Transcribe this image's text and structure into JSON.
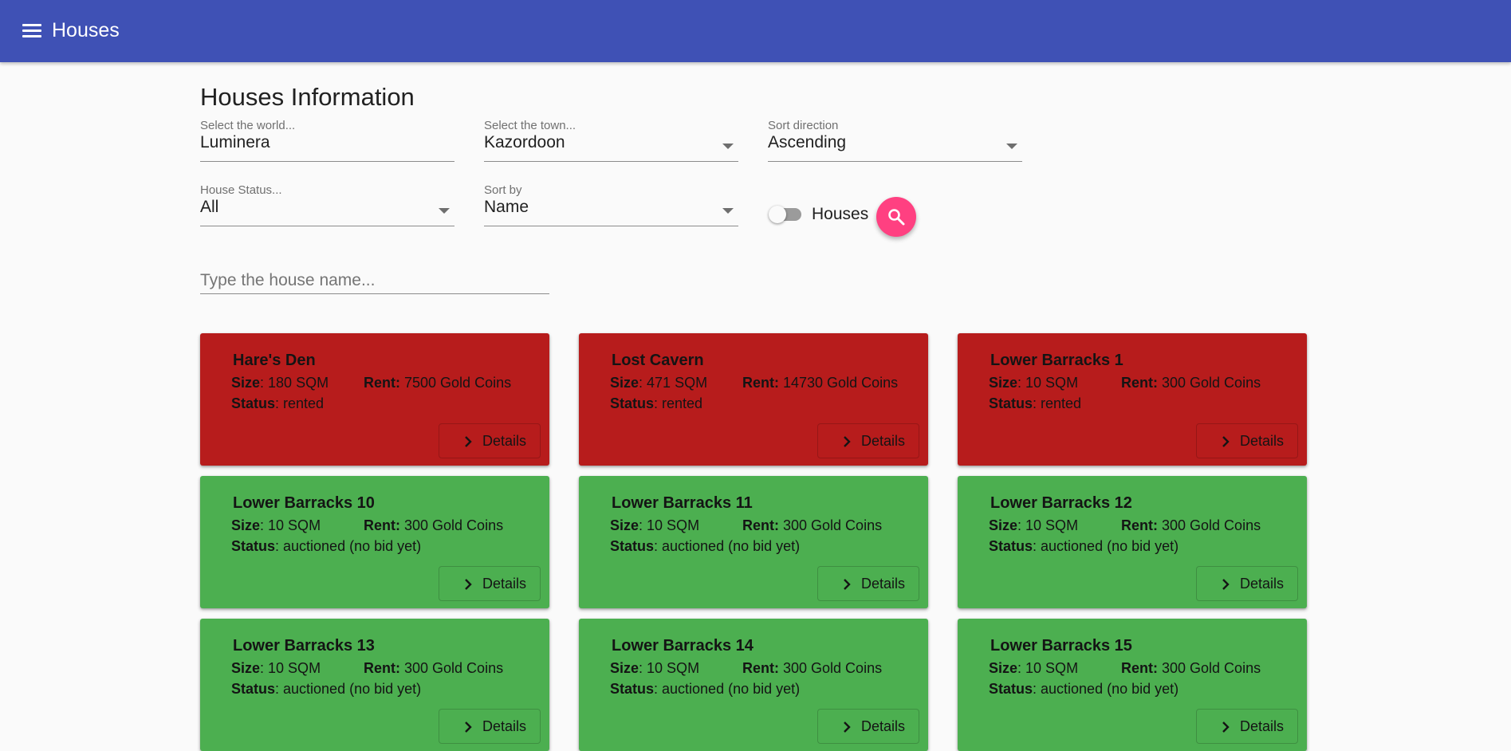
{
  "app": {
    "title": "Houses"
  },
  "page": {
    "title": "Houses Information"
  },
  "filters": {
    "world": {
      "label": "Select the world...",
      "value": "Luminera"
    },
    "town": {
      "label": "Select the town...",
      "value": "Kazordoon"
    },
    "sort_direction": {
      "label": "Sort direction",
      "value": "Ascending"
    },
    "house_status": {
      "label": "House Status...",
      "value": "All"
    },
    "sort_by": {
      "label": "Sort by",
      "value": "Name"
    },
    "toggle": {
      "label": "Houses",
      "checked": false
    },
    "search": {
      "placeholder": "Type the house name...",
      "value": ""
    }
  },
  "card_labels": {
    "size": "Size",
    "rent": "Rent",
    "status": "Status",
    "details": "Details"
  },
  "colors": {
    "toolbar": "#3f51b5",
    "rented": "#b71c1c",
    "auctioned": "#4caf50",
    "fab": "#ff4081"
  },
  "houses": [
    {
      "name": "Hare's Den",
      "size": ": 180 SQM",
      "rent": " 7500 Gold Coins",
      "status": ": rented"
    },
    {
      "name": "Lost Cavern",
      "size": ": 471 SQM",
      "rent": " 14730 Gold Coins",
      "status": ": rented"
    },
    {
      "name": "Lower Barracks 1",
      "size": ": 10 SQM",
      "rent": " 300 Gold Coins",
      "status": ": rented"
    },
    {
      "name": "Lower Barracks 10",
      "size": ": 10 SQM",
      "rent": " 300 Gold Coins",
      "status": ": auctioned (no bid yet)"
    },
    {
      "name": "Lower Barracks 11",
      "size": ": 10 SQM",
      "rent": " 300 Gold Coins",
      "status": ": auctioned (no bid yet)"
    },
    {
      "name": "Lower Barracks 12",
      "size": ": 10 SQM",
      "rent": " 300 Gold Coins",
      "status": ": auctioned (no bid yet)"
    },
    {
      "name": "Lower Barracks 13",
      "size": ": 10 SQM",
      "rent": " 300 Gold Coins",
      "status": ": auctioned (no bid yet)"
    },
    {
      "name": "Lower Barracks 14",
      "size": ": 10 SQM",
      "rent": " 300 Gold Coins",
      "status": ": auctioned (no bid yet)"
    },
    {
      "name": "Lower Barracks 15",
      "size": ": 10 SQM",
      "rent": " 300 Gold Coins",
      "status": ": auctioned (no bid yet)"
    }
  ]
}
